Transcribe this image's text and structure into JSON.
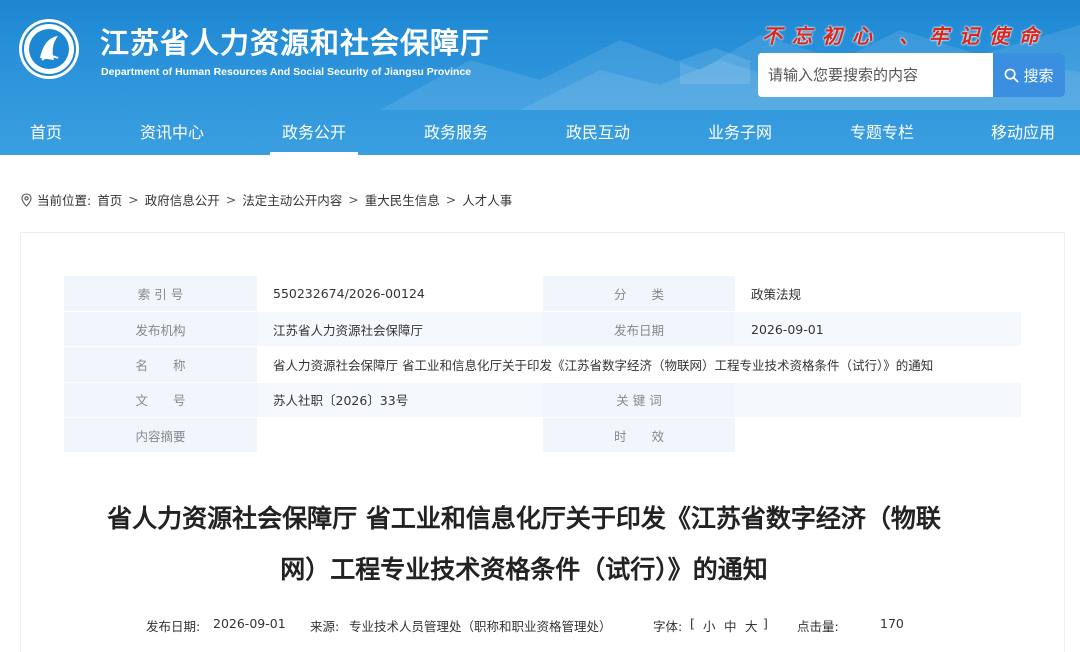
{
  "header": {
    "title": "江苏省人力资源和社会保障厅",
    "subtitle": "Department of Human Resources And Social Security of Jiangsu Province",
    "slogan": "不忘初心 、牢记使命",
    "search_placeholder": "请输入您要搜索的内容",
    "search_button": "搜索",
    "colors": {
      "header_bg": "#2f96dc",
      "slogan": "#d8261c",
      "search_button": "#3b8fe0"
    }
  },
  "nav": {
    "items": [
      {
        "label": "首页"
      },
      {
        "label": "资讯中心"
      },
      {
        "label": "政务公开",
        "active": true
      },
      {
        "label": "政务服务"
      },
      {
        "label": "政民互动"
      },
      {
        "label": "业务子网"
      },
      {
        "label": "专题专栏"
      },
      {
        "label": "移动应用"
      }
    ]
  },
  "breadcrumb": {
    "prefix": "当前位置:",
    "items": [
      "首页",
      "政府信息公开",
      "法定主动公开内容",
      "重大民生信息",
      "人才人事"
    ]
  },
  "meta_table": {
    "index_label": "索 引 号",
    "index_value": "550232674/2026-00124",
    "category_label": "分　　类",
    "category_value": "政策法规",
    "publisher_label": "发布机构",
    "publisher_value": "江苏省人力资源社会保障厅",
    "date_label": "发布日期",
    "date_value": "2026-09-01",
    "name_label": "名　　称",
    "name_value": "省人力资源社会保障厅 省工业和信息化厅关于印发《江苏省数字经济（物联网）工程专业技术资格条件（试行）》的通知",
    "docno_label": "文　　号",
    "docno_value": "苏人社职〔2026〕33号",
    "keywords_label": "关 键 词",
    "keywords_value": "",
    "summary_label": "内容摘要",
    "summary_value": "",
    "validity_label": "时　　效",
    "validity_value": ""
  },
  "document": {
    "title_line1": "省人力资源社会保障厅 省工业和信息化厅关于印发《江苏省数字经济（物联",
    "title_line2": "网）工程专业技术资格条件（试行）》的通知",
    "date_label": "发布日期:",
    "date_value": "2026-09-01",
    "source_label": "来源:",
    "source_value": "专业技术人员管理处（职称和职业资格管理处）",
    "fontsize_label": "字体:",
    "fontsize_open": "[",
    "fontsize_small": "小",
    "fontsize_medium": "中",
    "fontsize_large": "大",
    "fontsize_close": "]",
    "clicks_label": "点击量:",
    "clicks_value": "170"
  }
}
